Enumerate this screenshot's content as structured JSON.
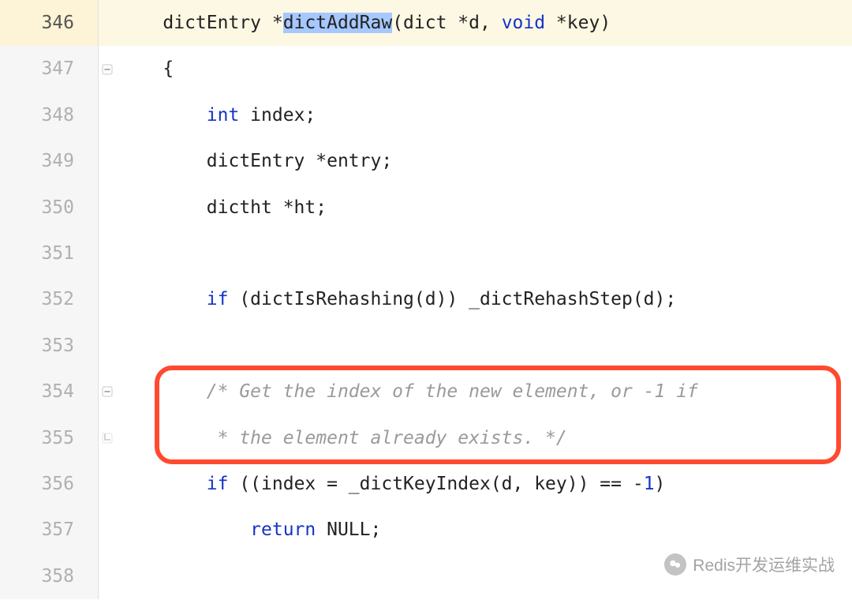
{
  "startLine": 346,
  "currentLine": 346,
  "highlight": {
    "firstLine": 354,
    "lastLine": 355
  },
  "lines": [
    {
      "num": 346,
      "indent": "    ",
      "fold": "none",
      "tokens": [
        {
          "t": "dictEntry *",
          "c": ""
        },
        {
          "t": "dictAddRaw",
          "c": "sel"
        },
        {
          "t": "(dict *d, ",
          "c": ""
        },
        {
          "t": "void",
          "c": "kw"
        },
        {
          "t": " *key)",
          "c": ""
        }
      ]
    },
    {
      "num": 347,
      "indent": "    ",
      "fold": "minus",
      "tokens": [
        {
          "t": "{",
          "c": ""
        }
      ]
    },
    {
      "num": 348,
      "indent": "        ",
      "fold": "none",
      "tokens": [
        {
          "t": "int",
          "c": "kw"
        },
        {
          "t": " index;",
          "c": ""
        }
      ]
    },
    {
      "num": 349,
      "indent": "        ",
      "fold": "none",
      "tokens": [
        {
          "t": "dictEntry *entry;",
          "c": ""
        }
      ]
    },
    {
      "num": 350,
      "indent": "        ",
      "fold": "none",
      "tokens": [
        {
          "t": "dictht *ht;",
          "c": ""
        }
      ]
    },
    {
      "num": 351,
      "indent": "",
      "fold": "none",
      "tokens": []
    },
    {
      "num": 352,
      "indent": "        ",
      "fold": "none",
      "tokens": [
        {
          "t": "if",
          "c": "kw"
        },
        {
          "t": " (dictIsRehashing(d)) _dictRehashStep(d);",
          "c": ""
        }
      ]
    },
    {
      "num": 353,
      "indent": "",
      "fold": "none",
      "tokens": []
    },
    {
      "num": 354,
      "indent": "        ",
      "fold": "minus",
      "tokens": [
        {
          "t": "/* Get the index of the new element, or -1 if",
          "c": "cm"
        }
      ]
    },
    {
      "num": 355,
      "indent": "        ",
      "fold": "end",
      "tokens": [
        {
          "t": " * the element already exists. */",
          "c": "cm"
        }
      ]
    },
    {
      "num": 356,
      "indent": "        ",
      "fold": "none",
      "tokens": [
        {
          "t": "if",
          "c": "kw"
        },
        {
          "t": " ((index = _dictKeyIndex(d, key)) == -",
          "c": ""
        },
        {
          "t": "1",
          "c": "kw"
        },
        {
          "t": ")",
          "c": ""
        }
      ]
    },
    {
      "num": 357,
      "indent": "            ",
      "fold": "none",
      "tokens": [
        {
          "t": "return",
          "c": "kw"
        },
        {
          "t": " NULL;",
          "c": ""
        }
      ]
    },
    {
      "num": 358,
      "indent": "",
      "fold": "none",
      "tokens": []
    }
  ],
  "watermark": {
    "text": "Redis开发运维实战"
  }
}
